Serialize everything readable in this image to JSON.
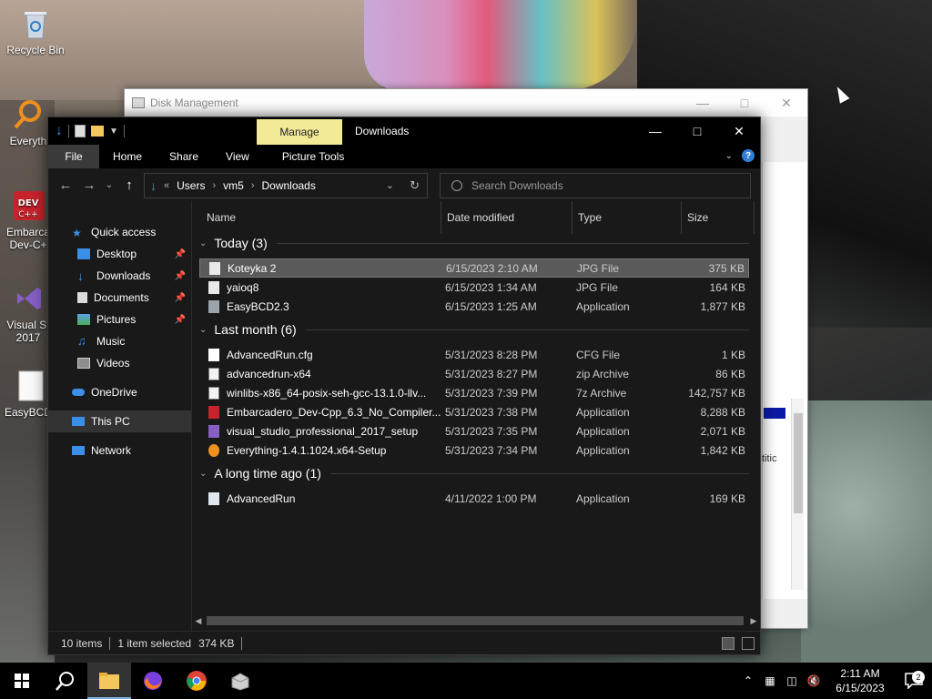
{
  "desktop": {
    "icons": [
      {
        "label": "Recycle Bin",
        "icon": "recycle-bin-icon"
      },
      {
        "label": "Everyth",
        "icon": "everything-search-icon"
      },
      {
        "label": "Embarca Dev-C+",
        "icon": "dev-cpp-icon"
      },
      {
        "label": "Visual St 2017",
        "icon": "visual-studio-icon"
      },
      {
        "label": "EasyBCD",
        "icon": "easybcd-icon"
      }
    ]
  },
  "disk_management": {
    "title": "Disk Management",
    "side_text": "titic"
  },
  "explorer": {
    "title": "Downloads",
    "manage_tab": "Manage",
    "ribbon_tabs": [
      "File",
      "Home",
      "Share",
      "View",
      "Picture Tools"
    ],
    "address": {
      "overflow": "«",
      "crumbs": [
        "Users",
        "vm5",
        "Downloads"
      ]
    },
    "search_placeholder": "Search Downloads",
    "nav": {
      "quick_access": "Quick access",
      "quick_items": [
        {
          "label": "Desktop",
          "pinned": true
        },
        {
          "label": "Downloads",
          "pinned": true
        },
        {
          "label": "Documents",
          "pinned": true
        },
        {
          "label": "Pictures",
          "pinned": true
        },
        {
          "label": "Music",
          "pinned": false
        },
        {
          "label": "Videos",
          "pinned": false
        }
      ],
      "onedrive": "OneDrive",
      "this_pc": "This PC",
      "network": "Network"
    },
    "columns": [
      "Name",
      "Date modified",
      "Type",
      "Size"
    ],
    "groups": [
      {
        "title": "Today (3)",
        "files": [
          {
            "name": "Koteyka 2",
            "date": "6/15/2023 2:10 AM",
            "type": "JPG File",
            "size": "375 KB",
            "selected": true
          },
          {
            "name": "yaioq8",
            "date": "6/15/2023 1:34 AM",
            "type": "JPG File",
            "size": "164 KB"
          },
          {
            "name": "EasyBCD2.3",
            "date": "6/15/2023 1:25 AM",
            "type": "Application",
            "size": "1,877 KB"
          }
        ]
      },
      {
        "title": "Last month (6)",
        "files": [
          {
            "name": "AdvancedRun.cfg",
            "date": "5/31/2023 8:28 PM",
            "type": "CFG File",
            "size": "1 KB"
          },
          {
            "name": "advancedrun-x64",
            "date": "5/31/2023 8:27 PM",
            "type": "zip Archive",
            "size": "86 KB"
          },
          {
            "name": "winlibs-x86_64-posix-seh-gcc-13.1.0-llv...",
            "date": "5/31/2023 7:39 PM",
            "type": "7z Archive",
            "size": "142,757 KB"
          },
          {
            "name": "Embarcadero_Dev-Cpp_6.3_No_Compiler...",
            "date": "5/31/2023 7:38 PM",
            "type": "Application",
            "size": "8,288 KB"
          },
          {
            "name": "visual_studio_professional_2017_setup",
            "date": "5/31/2023 7:35 PM",
            "type": "Application",
            "size": "2,071 KB"
          },
          {
            "name": "Everything-1.4.1.1024.x64-Setup",
            "date": "5/31/2023 7:34 PM",
            "type": "Application",
            "size": "1,842 KB"
          }
        ]
      },
      {
        "title": "A long time ago (1)",
        "files": [
          {
            "name": "AdvancedRun",
            "date": "4/11/2022 1:00 PM",
            "type": "Application",
            "size": "169 KB"
          }
        ]
      }
    ],
    "status": {
      "items": "10 items",
      "selected": "1 item selected",
      "selected_size": "374 KB"
    }
  },
  "taskbar": {
    "time": "2:11 AM",
    "date": "6/15/2023",
    "notification_count": "2"
  },
  "colors": {
    "accent": "#3b8fe8",
    "manage_tab": "#f3ea98",
    "explorer_bg": "#191919"
  }
}
